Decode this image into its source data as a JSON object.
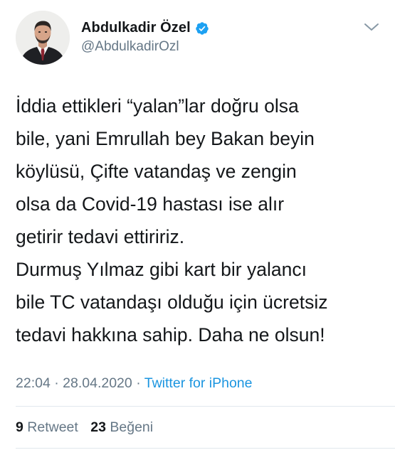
{
  "author": {
    "display_name": "Abdulkadir Özel",
    "handle": "@AbdulkadirOzl",
    "verified": true,
    "avatar_icon": "profile-photo-man-in-suit"
  },
  "tweet": {
    "lines": [
      "İddia ettikleri “yalan”lar doğru olsa",
      "bile, yani Emrullah bey Bakan beyin",
      "köylüsü, Çifte vatandaş ve zengin",
      "olsa da Covid-19 hastası ise alır",
      "getirir tedavi ettiririz.",
      "Durmuş Yılmaz gibi kart bir yalancı",
      "bile TC vatandaşı olduğu için ücretsiz",
      "tedavi hakkına sahip. Daha ne olsun!"
    ],
    "time": "22:04",
    "separator": "·",
    "date": "28.04.2020",
    "source": "Twitter for iPhone"
  },
  "stats": {
    "retweet_count": "9",
    "retweet_label": "Retweet",
    "like_count": "23",
    "like_label": "Beğeni"
  },
  "colors": {
    "text": "#14171a",
    "secondary": "#657786",
    "link": "#1b95e0",
    "verified": "#1da1f2",
    "divider": "#e1e8ed"
  },
  "icons": {
    "verified": "verified-badge-icon",
    "menu": "chevron-down-icon"
  }
}
